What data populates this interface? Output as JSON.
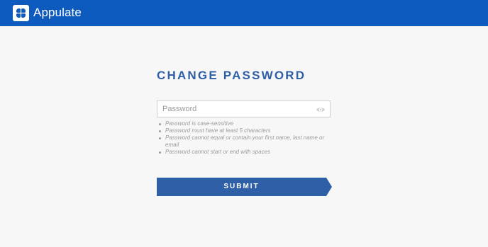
{
  "header": {
    "brand": "Appulate",
    "background_color": "#0e5bbf",
    "logo_icon": "clover-icon"
  },
  "form": {
    "title": "CHANGE PASSWORD",
    "password": {
      "value": "",
      "placeholder": "Password",
      "toggle_icon": "eye-icon"
    },
    "rules": [
      "Password is case-sensitive",
      "Password must have at least 5 characters",
      "Password cannot equal or contain your first name, last name or email",
      "Password cannot start or end with spaces"
    ],
    "submit_label": "SUBMIT",
    "accent_color": "#2f5fa7"
  }
}
